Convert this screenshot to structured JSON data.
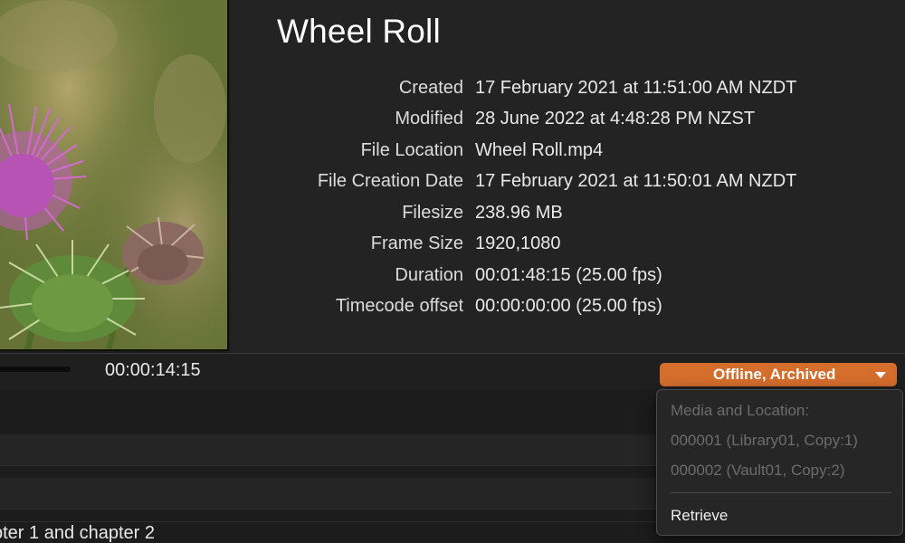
{
  "clip": {
    "title": "Wheel Roll",
    "metadata": [
      {
        "label": "Created",
        "value": "17 February 2021 at 11:51:00 AM NZDT"
      },
      {
        "label": "Modified",
        "value": "28 June 2022 at 4:48:28 PM NZST"
      },
      {
        "label": "File Location",
        "value": "Wheel Roll.mp4"
      },
      {
        "label": "File Creation Date",
        "value": "17 February 2021 at 11:50:01 AM NZDT"
      },
      {
        "label": "Filesize",
        "value": "238.96 MB"
      },
      {
        "label": "Frame Size",
        "value": "1920,1080"
      },
      {
        "label": "Duration",
        "value": "00:01:48:15 (25.00 fps)"
      },
      {
        "label": "Timecode offset",
        "value": "00:00:00:00 (25.00 fps)"
      }
    ]
  },
  "player": {
    "timecode": "00:00:14:15"
  },
  "status": {
    "label": "Offline, Archived",
    "color": "#d56d2c"
  },
  "status_menu": {
    "header": "Media and Location:",
    "items": [
      {
        "label": "000001 (Library01, Copy:1)",
        "enabled": false
      },
      {
        "label": "000002 (Vault01, Copy:2)",
        "enabled": false
      }
    ],
    "action": "Retrieve"
  },
  "list": {
    "partial_row_text": "pter 1 and chapter 2"
  },
  "icons": {
    "status_dropdown": "chevron-down-icon",
    "thumbnail": "thistle-flower-thumbnail"
  }
}
